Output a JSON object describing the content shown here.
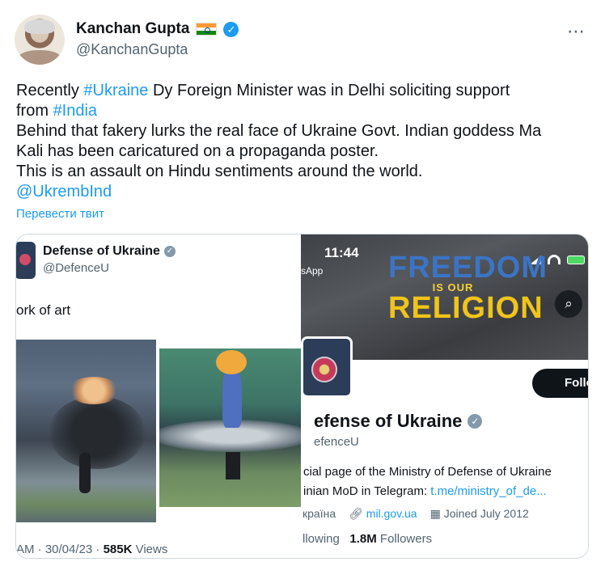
{
  "author": {
    "name": "Kanchan Gupta",
    "handle": "@KanchanGupta"
  },
  "more_icon": "⋯",
  "tweet": {
    "line1_pre": "Recently ",
    "line1_tag": "#Ukraine",
    "line1_post": " Dy Foreign Minister was in Delhi soliciting support",
    "line2_pre": "from ",
    "line2_tag": "#India",
    "line3": "Behind that fakery lurks the real face of Ukraine Govt. Indian goddess Ma",
    "line4": "Kali has been caricatured on a propaganda poster.",
    "line5": "This is an assault on Hindu sentiments around the world.",
    "mention": "@UkrembInd"
  },
  "translate_label": "Перевести твит",
  "embedded_left": {
    "name": "Defense of Ukraine",
    "handle": "@DefenceU",
    "text": "ork of art",
    "meta_prefix": "AM · 30/04/23 · ",
    "views_count": "585K",
    "views_label": " Views"
  },
  "embedded_right": {
    "time": "11:44",
    "app": "sApp",
    "banner_line1": "FREEDOM",
    "banner_line2": "IS OUR",
    "banner_line3": "RELIGION",
    "follow_label": "Follow",
    "name": "efense of Ukraine",
    "handle": "efenceU",
    "bio_line1": "cial page of the Ministry of Defense of Ukraine",
    "bio_line2_pre": "inian MoD in Telegram: ",
    "bio_line2_link": "t.me/ministry_of_de...",
    "location": "країна",
    "website": "mil.gov.ua",
    "joined": "Joined July 2012",
    "following_label": "llowing",
    "followers_count": "1.8M",
    "followers_label": "Followers"
  },
  "colors": {
    "link": "#1d9bf0",
    "text": "#0f1419",
    "muted": "#536471",
    "border": "#cfd9de"
  }
}
